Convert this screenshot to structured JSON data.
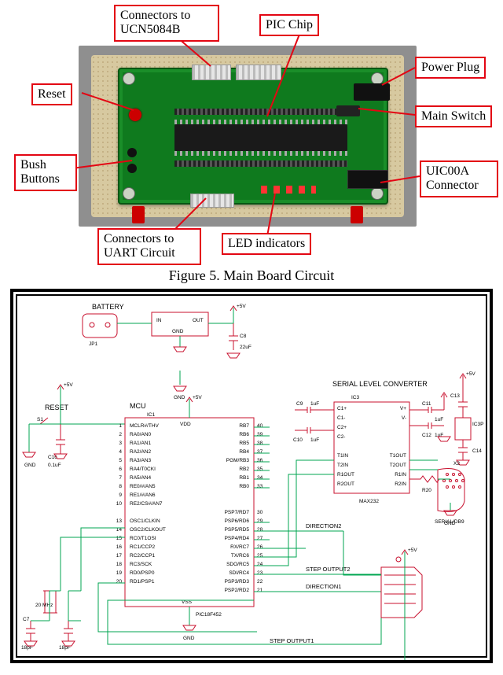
{
  "figure5": {
    "caption": "Figure 5. Main Board Circuit",
    "callouts": {
      "ucn": "Connectors to\nUCN5084B",
      "pic": "PIC Chip",
      "power": "Power Plug",
      "reset": "Reset",
      "main": "Main Switch",
      "bush": "Bush\nButtons",
      "uic": "UIC00A\nConnector",
      "uart": "Connectors to\nUART Circuit",
      "led": "LED indicators"
    },
    "components": {
      "reset_btn": "reset-button",
      "bush_btn": "bush-button",
      "chip": "pic-chip",
      "top_conn_a": "ucn-connector-a",
      "top_conn_b": "ucn-connector-b",
      "power": "power-plug",
      "switch": "main-switch",
      "uic": "uic00a-connector",
      "uart": "uart-connector",
      "led": "led-indicators"
    }
  },
  "schematic": {
    "blocks": {
      "battery": "BATTERY",
      "jp1": "JP1",
      "reg_in": "IN",
      "reg_out": "OUT",
      "reg_gnd": "GND",
      "c8": "C8",
      "c8_val": "22uF",
      "serial_conv": "SERIAL LEVEL CONVERTER",
      "ic3": "IC3",
      "reset": "RESET",
      "s1": "S1",
      "c16": "C16",
      "c16_val": "0.1uF",
      "mcu": "MCU",
      "ic1": "IC1",
      "vdd": "VDD",
      "pic": "PIC18F452",
      "vss": "VSS",
      "gnd": "GND",
      "p5v": "+5V",
      "c9": "C9",
      "c9_val": "1uF",
      "c10": "C10",
      "c10_val": "1uF",
      "c11": "C11",
      "c11_val": "1uF",
      "c12": "C12",
      "c12_val": "1uF",
      "r20": "R20",
      "c13": "C13",
      "ic3p": "IC3P",
      "c14": "C14",
      "max232": "MAX232",
      "x2": "X2",
      "serial_db9": "SERIAL/DB9",
      "direction1": "DIRECTION1",
      "direction2": "DIRECTION2",
      "step1": "STEP OUTPUT1",
      "step2": "STEP OUTPUT2",
      "xtal": "20 MHz",
      "c7": "C7",
      "c7_val": "18pF",
      "c7b_val": "18pF"
    },
    "mcu_pins_left": [
      "MCLR#/THV",
      "RA0/AN0",
      "RA1/AN1",
      "RA2/AN2",
      "RA3/AN3",
      "RA4/T0CKI",
      "RA5/AN4",
      "RE0/#/AN5",
      "RE1/#/AN6",
      "RE2/CS#/AN7",
      "",
      "OSC1/CLKIN",
      "OSC2/CLKOUT",
      "RC0/T1OSI",
      "RC1/CCP2",
      "RC2/CCP1",
      "RC3/SCK",
      "RD0/PSP0",
      "RD1/PSP1"
    ],
    "mcu_pins_left_nums": [
      "1",
      "2",
      "3",
      "4",
      "5",
      "6",
      "7",
      "8",
      "9",
      "10",
      "",
      "13",
      "14",
      "15",
      "16",
      "17",
      "18",
      "19",
      "20"
    ],
    "mcu_pins_right": [
      "RB7",
      "RB6",
      "RB5",
      "RB4",
      "PGM/RB3",
      "RB2",
      "RB1",
      "RB0",
      "",
      "",
      "PSP7/RD7",
      "PSP6/RD6",
      "PSP5/RD5",
      "PSP4/RD4",
      "RX/RC7",
      "TX/RC6",
      "SDO/RC5",
      "SDI/RC4",
      "PSP3/RD3",
      "PSP2/RD2"
    ],
    "mcu_pins_right_nums": [
      "40",
      "39",
      "38",
      "37",
      "36",
      "35",
      "34",
      "33",
      "",
      "",
      "30",
      "29",
      "28",
      "27",
      "26",
      "25",
      "24",
      "23",
      "22",
      "21"
    ],
    "max_pins_left": [
      "C1+",
      "C1-",
      "C2+",
      "C2-",
      "",
      "T1IN",
      "T2IN",
      "R1OUT",
      "R2OUT"
    ],
    "max_pins_right": [
      "V+",
      "V-",
      "",
      "",
      "",
      "T1OUT",
      "T2OUT",
      "R1IN",
      "R2IN"
    ]
  }
}
